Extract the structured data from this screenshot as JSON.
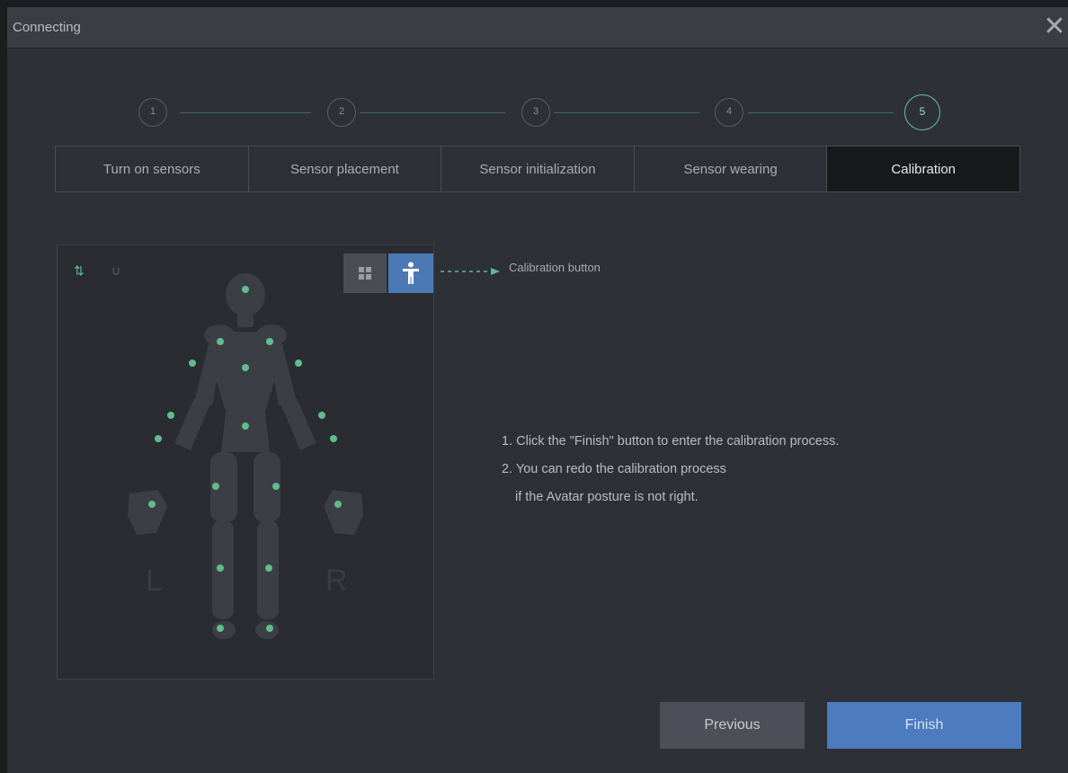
{
  "window": {
    "title": "Connecting"
  },
  "steps": [
    {
      "number": "1",
      "label": "Turn on sensors",
      "active": false
    },
    {
      "number": "2",
      "label": "Sensor placement",
      "active": false
    },
    {
      "number": "3",
      "label": "Sensor initialization",
      "active": false
    },
    {
      "number": "4",
      "label": "Sensor wearing",
      "active": false
    },
    {
      "number": "5",
      "label": "Calibration",
      "active": true
    }
  ],
  "avatar": {
    "left_label": "L",
    "right_label": "R",
    "toolbar": {
      "left_icon": "swap-arrows-icon",
      "right_icon": "magnet-icon"
    },
    "buttons": [
      {
        "name": "grid-view"
      },
      {
        "name": "calibration"
      }
    ]
  },
  "callout": {
    "label": "Calibration button"
  },
  "instructions": {
    "line1": "1. Click the \"Finish\" button to enter the calibration process.",
    "line2": "2. You can redo the calibration process",
    "line3": "if the Avatar posture is not right."
  },
  "footer": {
    "previous": "Previous",
    "finish": "Finish"
  },
  "colors": {
    "accent": "#4c7bc0",
    "sensor": "#5fbd8e",
    "active_step": "#63c39a"
  }
}
